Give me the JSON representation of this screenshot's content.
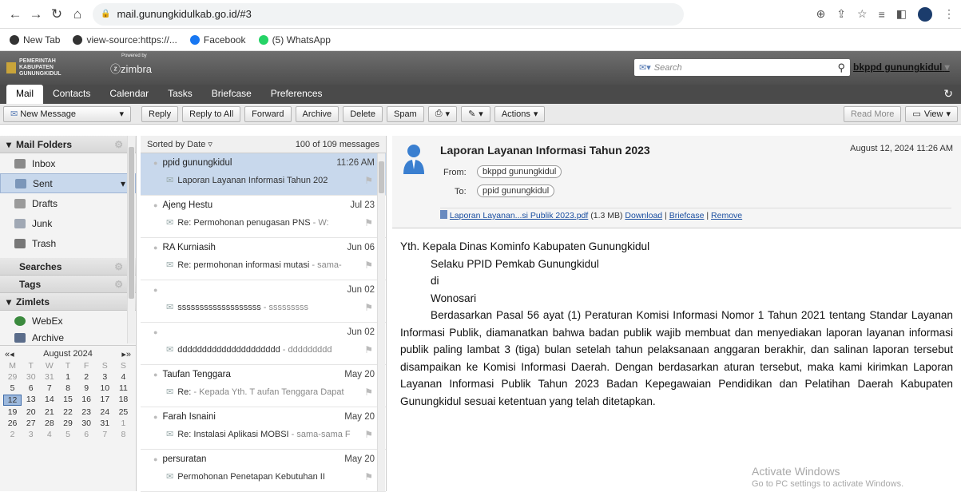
{
  "browser": {
    "url": "mail.gunungkidulkab.go.id/#3",
    "bookmarks": [
      "New Tab",
      "view-source:https://...",
      "Facebook",
      "(5) WhatsApp"
    ]
  },
  "header": {
    "logo_text": "PEMERINTAH KABUPATEN GUNUNGKIDUL",
    "powered_by": "Powered by",
    "product": "zimbra",
    "search_placeholder": "Search",
    "user": "bkppd gunungkidul"
  },
  "tabs": [
    "Mail",
    "Contacts",
    "Calendar",
    "Tasks",
    "Briefcase",
    "Preferences"
  ],
  "toolbar": {
    "new_message": "New Message",
    "reply": "Reply",
    "reply_all": "Reply to All",
    "forward": "Forward",
    "archive": "Archive",
    "delete": "Delete",
    "spam": "Spam",
    "actions": "Actions",
    "read_more": "Read More",
    "view": "View"
  },
  "sidebar": {
    "mail_folders": "Mail Folders",
    "folders": [
      "Inbox",
      "Sent",
      "Drafts",
      "Junk",
      "Trash"
    ],
    "searches": "Searches",
    "tags": "Tags",
    "zimlets": "Zimlets",
    "zimlet_items": [
      "WebEx",
      "Archive"
    ],
    "calendar": {
      "month": "August 2024",
      "weekdays": [
        "M",
        "T",
        "W",
        "T",
        "F",
        "S",
        "S"
      ],
      "days": [
        "29",
        "30",
        "31",
        "1",
        "2",
        "3",
        "4",
        "5",
        "6",
        "7",
        "8",
        "9",
        "10",
        "11",
        "12",
        "13",
        "14",
        "15",
        "16",
        "17",
        "18",
        "19",
        "20",
        "21",
        "22",
        "23",
        "24",
        "25",
        "26",
        "27",
        "28",
        "29",
        "30",
        "31",
        "1",
        "2",
        "3",
        "4",
        "5",
        "6",
        "7",
        "8"
      ]
    }
  },
  "message_list": {
    "sort": "Sorted by Date",
    "count": "100 of 109 messages",
    "messages": [
      {
        "from": "ppid gunungkidul",
        "date": "11:26 AM",
        "subject": "Laporan Layanan Informasi Tahun 202",
        "fragment": ""
      },
      {
        "from": "Ajeng Hestu",
        "date": "Jul 23",
        "subject": "Re: Permohonan penugasan PNS",
        "fragment": " - W:"
      },
      {
        "from": "RA Kurniasih",
        "date": "Jun 06",
        "subject": "Re: permohonan informasi mutasi",
        "fragment": " - sama-"
      },
      {
        "from": "",
        "date": "Jun 02",
        "subject": "sssssssssssssssssss",
        "fragment": " - sssssssss"
      },
      {
        "from": "",
        "date": "Jun 02",
        "subject": "ddddddddddddddddddddd",
        "fragment": " - ddddddddd"
      },
      {
        "from": "Taufan Tenggara",
        "date": "May 20",
        "subject": "Re:",
        "fragment": " - Kepada Yth. T aufan Tenggara Dapat"
      },
      {
        "from": "Farah Isnaini",
        "date": "May 20",
        "subject": "Re: Instalasi Aplikasi MOBSI",
        "fragment": " - sama-sama F"
      },
      {
        "from": "persuratan",
        "date": "May 20",
        "subject": "Permohonan Penetapan Kebutuhan II",
        "fragment": ""
      }
    ]
  },
  "reader": {
    "subject": "Laporan Layanan Informasi Tahun 2023",
    "date": "August 12, 2024 11:26 AM",
    "from_label": "From:",
    "from": "bkppd gunungkidul",
    "to_label": "To:",
    "to": "ppid gunungkidul",
    "attachment": "Laporan Layanan...si Publik 2023.pdf",
    "attachment_size": "(1.3 MB)",
    "download": "Download",
    "briefcase": "Briefcase",
    "remove": "Remove",
    "body_lines": [
      "Yth. Kepala Dinas Kominfo Kabupaten Gunungkidul",
      "Selaku PPID Pemkab Gunungkidul",
      "di",
      "Wonosari"
    ],
    "body_para": "Berdasarkan Pasal 56 ayat (1) Peraturan Komisi Informasi Nomor 1 Tahun 2021 tentang Standar Layanan Informasi Publik, diamanatkan bahwa badan publik wajib membuat dan menyediakan laporan layanan informasi publik paling lambat 3 (tiga) bulan setelah tahun pelaksanaan anggaran berakhir, dan salinan laporan tersebut disampaikan ke Komisi Informasi Daerah. Dengan berdasarkan aturan tersebut, maka kami kirimkan Laporan Layanan Informasi Publik Tahun 2023 Badan Kepegawaian Pendidikan dan Pelatihan Daerah Kabupaten Gunungkidul sesuai ketentuan yang telah ditetapkan."
  },
  "watermark": {
    "title": "Activate Windows",
    "sub": "Go to PC settings to activate Windows."
  }
}
